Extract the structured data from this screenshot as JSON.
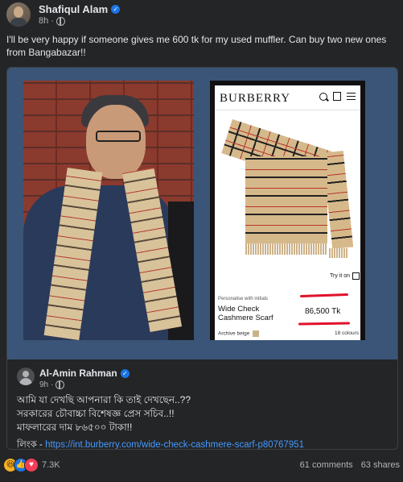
{
  "post": {
    "author": "Shafiqul Alam",
    "time": "8h",
    "caption": "I'll be very happy if someone gives me 600 tk for my used muffler. Can buy two new ones from Bangabazar!!"
  },
  "product_screen": {
    "brand": "BURBERRY",
    "try_on": "Try it on",
    "personalise": "Personalise with initials",
    "name": "Wide Check Cashmere Scarf",
    "price": "86,500 Tk",
    "colour": "Archive beige",
    "colours_count": "18 colours"
  },
  "comment": {
    "author": "Al-Amin Rahman",
    "time": "9h",
    "line1": "আমি যা দেখছি আপনারা কি তাই দেখছেন..??",
    "line2": "সরকারের চৌবাচ্চা বিশেষজ্ঞ প্রেস সচিব..!!",
    "line3": "মাফলারের দাম ৮৬৫০০ টাকা!!",
    "link_label": "লিংক - ",
    "link_url": "https://int.burberry.com/wide-check-cashmere-scarf-p80767951"
  },
  "footer": {
    "reactions_count": "7.3K",
    "comments": "61 comments",
    "shares": "63 shares",
    "reaction_icons": [
      "haha-icon",
      "like-icon",
      "love-icon"
    ]
  },
  "colors": {
    "background": "#242526",
    "shared_image_bg": "#3b5578",
    "link": "#4599ff",
    "price_underline": "#e0112b",
    "verified": "#1b74e4"
  }
}
